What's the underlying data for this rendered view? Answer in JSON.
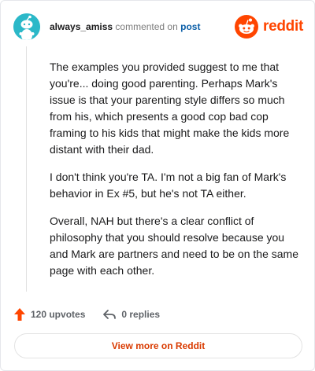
{
  "comment": {
    "username": "always_amiss",
    "action_text": "commented on",
    "post_link_text": "post",
    "paragraphs": [
      "The examples you provided suggest to me that you're... doing good parenting. Perhaps Mark's issue is that your parenting style differs so much from his, which presents a good cop bad cop framing to his kids that might make the kids more distant with their dad.",
      "I don't think you're TA. I'm not a big fan of Mark's behavior in Ex #5, but he's not TA either.",
      "Overall, NAH but there's a clear conflict of philosophy that you should resolve because you and Mark are partners and need to be on the same page with each other."
    ]
  },
  "brand": {
    "name": "reddit",
    "accent": "#ff4500"
  },
  "actions": {
    "upvotes_label": "120 upvotes",
    "replies_label": "0 replies"
  },
  "view_more_label": "View more on Reddit",
  "colors": {
    "avatar_bg": "#2bb8c8",
    "upvote": "#ff4500",
    "link": "#0b5fa8",
    "view_more_text": "#d93a00"
  },
  "icons": {
    "avatar": "snoo-avatar-icon",
    "brand": "reddit-logo-icon",
    "upvote": "upvote-arrow-icon",
    "reply": "reply-arrow-icon"
  }
}
